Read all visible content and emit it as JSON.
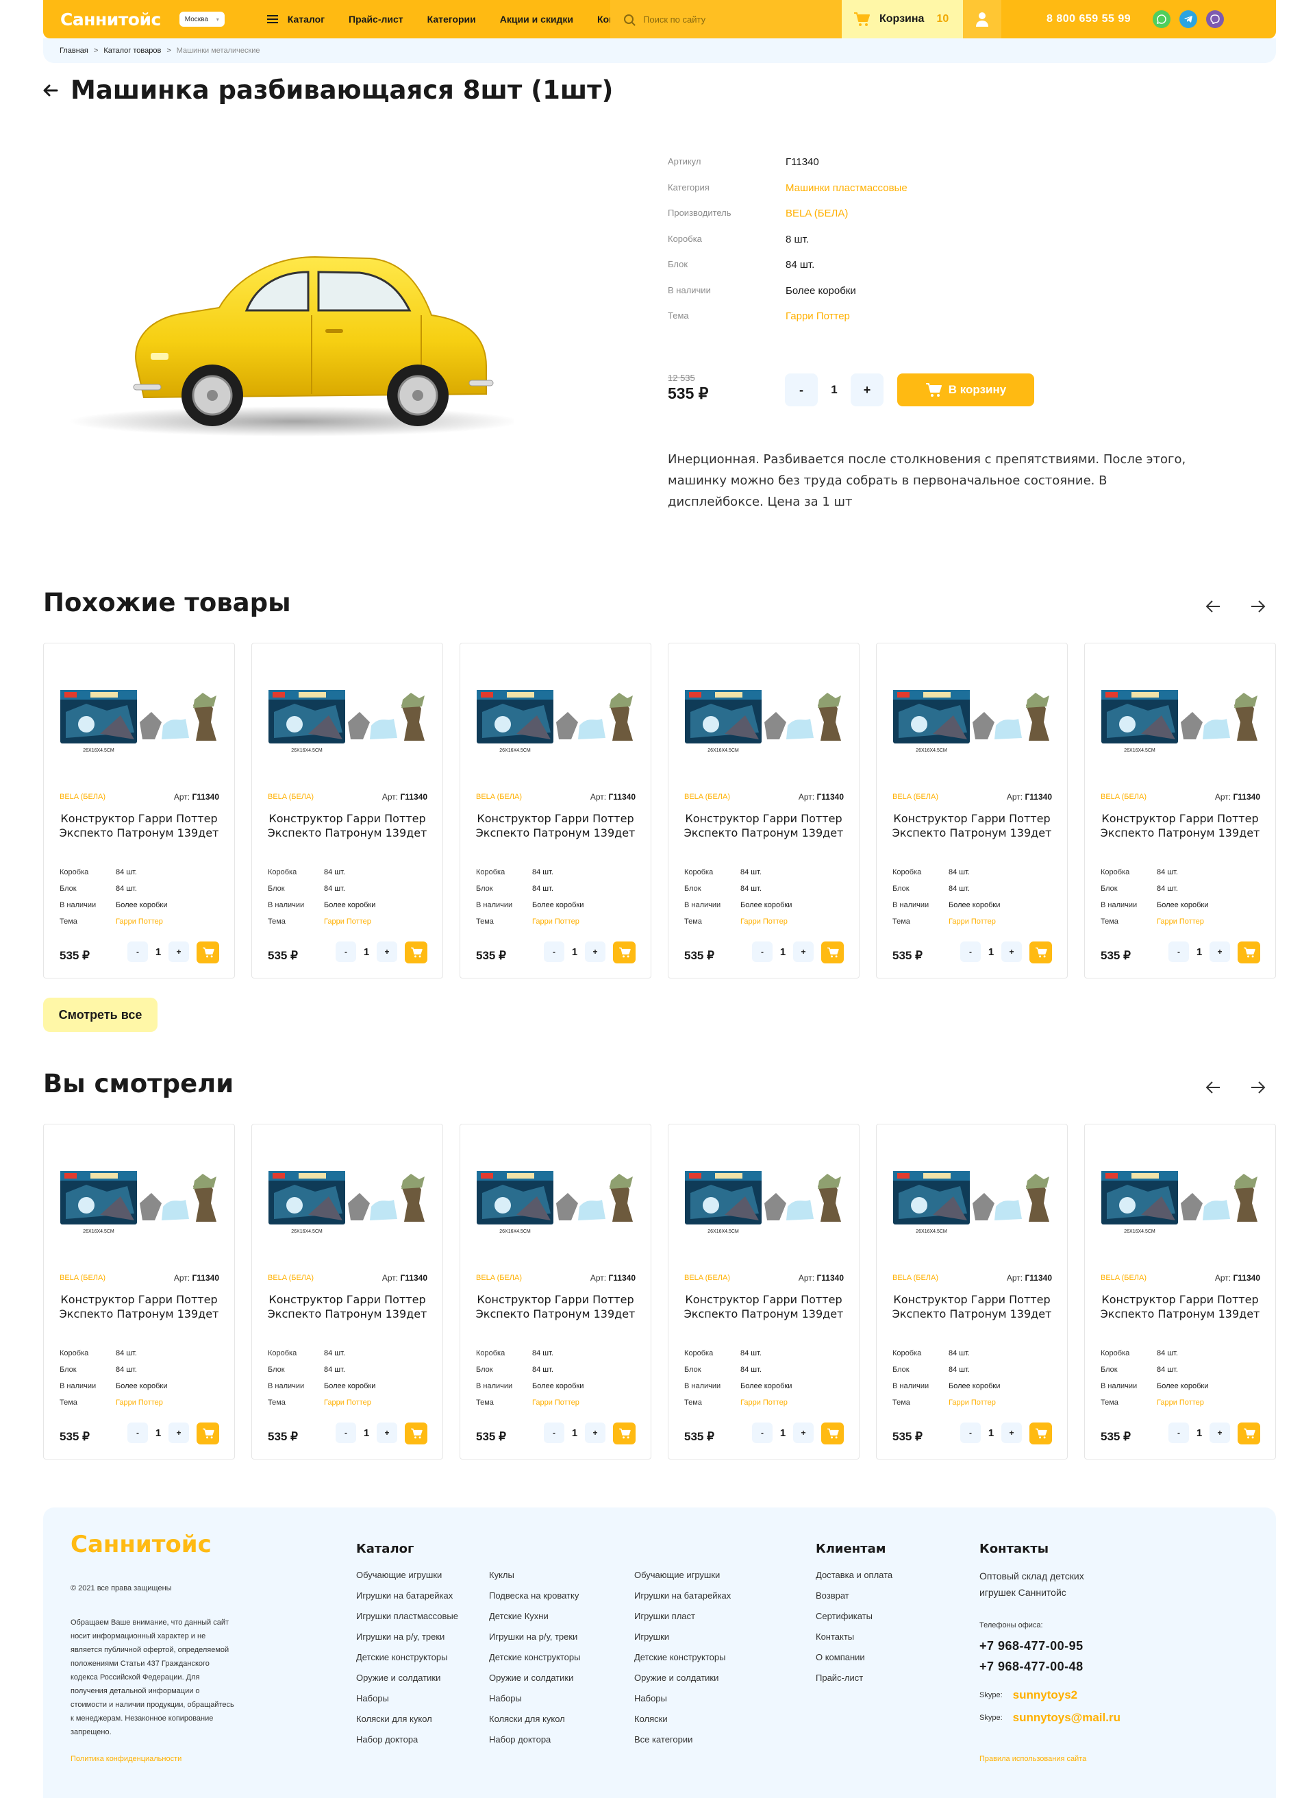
{
  "header": {
    "logo": "Саннитойс",
    "city": "Москва",
    "nav": [
      "Каталог",
      "Прайс-лист",
      "Категории",
      "Акции и скидки",
      "Контакты"
    ],
    "search_placeholder": "Поиск по сайту",
    "cart_label": "Корзина",
    "cart_count": "10",
    "phone": "8 800 659 55 99"
  },
  "breadcrumb": [
    "Главная",
    "Каталог товаров",
    "Машинки металические"
  ],
  "product": {
    "title": "Машинка разбивающаяся 8шт (1шт)",
    "specs": [
      {
        "k": "Артикул",
        "v": "Г11340",
        "link": false
      },
      {
        "k": "Категория",
        "v": "Машинки пластмассовые",
        "link": true
      },
      {
        "k": "Производитель",
        "v": "BELA (БЕЛА)",
        "link": true
      },
      {
        "k": "Коробка",
        "v": "8 шт.",
        "link": false
      },
      {
        "k": "Блок",
        "v": "84 шт.",
        "link": false
      },
      {
        "k": "В наличии",
        "v": "Более коробки",
        "link": false
      },
      {
        "k": "Тема",
        "v": "Гарри Поттер",
        "link": true
      }
    ],
    "old_price": "12 535",
    "price": "535 ₽",
    "qty": "1",
    "minus": "-",
    "plus": "+",
    "add_to_cart": "В корзину",
    "description": "Инерционная. Разбивается после столкновения с препятствиями. После этого, машинку можно без труда собрать в первоначальное состояние. В дисплейбоксе. Цена за 1 шт"
  },
  "similar": {
    "title": "Похожие товары",
    "see_all": "Смотреть все"
  },
  "viewed": {
    "title": "Вы смотрели"
  },
  "card": {
    "brand": "BELA (БЕЛА)",
    "art_label": "Арт:",
    "art": "Г11340",
    "name": "Конструктор Гарри Поттер Экспекто Патронум 139дет",
    "specs": [
      {
        "k": "Коробка",
        "v": "84 шт.",
        "link": false
      },
      {
        "k": "Блок",
        "v": "84 шт.",
        "link": false
      },
      {
        "k": "В наличии",
        "v": "Более коробки",
        "link": false
      },
      {
        "k": "Тема",
        "v": "Гарри Поттер",
        "link": true
      }
    ],
    "price": "535 ₽",
    "qty": "1",
    "minus": "-",
    "plus": "+",
    "box_label": "26X16X4.5CM"
  },
  "footer": {
    "logo": "Саннитойс",
    "copyright": "© 2021 все права защищены",
    "note": "Обращаем Ваше внимание, что данный сайт носит информационный характер и не является публичной офертой, определяемой положениями Статьи 437 Гражданского кодекса Российской Федерации. Для получения детальной информации о стоимости и наличии продукции, обращайтесь к менеджерам. Незаконное копирование запрещено.",
    "policy": "Политика конфиденциальности",
    "catalog_title": "Каталог",
    "catalog_col1": [
      "Обучающие игрушки",
      "Игрушки на батарейках",
      "Игрушки пластмассовые",
      "Игрушки на р/у, треки",
      "Детские конструкторы",
      "Оружие и солдатики",
      "Наборы",
      "Коляски для кукол",
      "Набор доктора"
    ],
    "catalog_col2": [
      "Куклы",
      "Подвеска на кроватку",
      "Детские Кухни",
      "Игрушки на р/у, треки",
      "Детские конструкторы",
      "Оружие и солдатики",
      "Наборы",
      "Коляски для кукол",
      "Набор доктора"
    ],
    "catalog_col3": [
      "Обучающие игрушки",
      "Игрушки на батарейках",
      "Игрушки пласт",
      "Игрушки",
      "Детские конструкторы",
      "Оружие и солдатики",
      "Наборы",
      "Коляски",
      "Все категории"
    ],
    "clients_title": "Клиентам",
    "clients": [
      "Доставка и оплата",
      "Возврат",
      "Сертификаты",
      "Контакты",
      "О компании",
      "Прайс-лист"
    ],
    "contacts_title": "Контакты",
    "contacts_text": "Оптовый склад детских игрушек Саннитойс",
    "phones_label": "Телефоны офиса:",
    "phone1": "+7 968-477-00-95",
    "phone2": "+7 968-477-00-48",
    "skype_label": "Skype:",
    "skype": "sunnytoys2",
    "skype2": "sunnytoys@mail.ru",
    "rules": "Правила использования сайта"
  },
  "colors": {
    "accent": "#ffba12",
    "accent_light": "#fff7a7",
    "link": "#ffb000",
    "bg_light": "#f0f8ff"
  }
}
